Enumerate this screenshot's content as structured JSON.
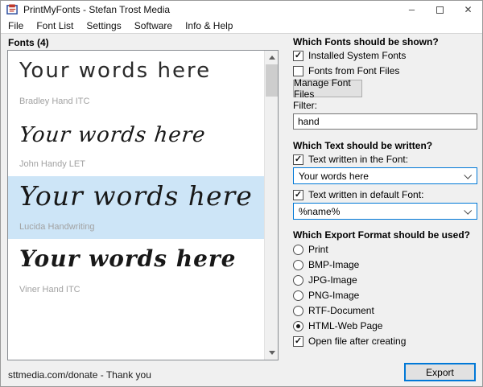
{
  "window": {
    "title": "PrintMyFonts - Stefan Trost Media",
    "icons": {
      "minimize_glyph": "–",
      "close_glyph": "✕"
    }
  },
  "menu": {
    "items": [
      "File",
      "Font List",
      "Settings",
      "Software",
      "Info & Help"
    ]
  },
  "fonts_panel": {
    "header": "Fonts (4)",
    "items": [
      {
        "preview": "Your words here",
        "font_name": "Bradley Hand ITC",
        "selected": false
      },
      {
        "preview": "Your words here",
        "font_name": "John Handy LET",
        "selected": false
      },
      {
        "preview": "Your words here",
        "font_name": "Lucida Handwriting",
        "selected": true
      },
      {
        "preview": "Your words here",
        "font_name": "Viner Hand ITC",
        "selected": false
      }
    ]
  },
  "options_panel": {
    "fonts_section": {
      "header": "Which Fonts should be shown?",
      "checkboxes": [
        {
          "label": "Installed System Fonts",
          "checked": true
        },
        {
          "label": "Fonts from Font Files",
          "checked": false
        }
      ],
      "manage_button": "Manage Font Files",
      "filter_label": "Filter:",
      "filter_value": "hand"
    },
    "text_section": {
      "header": "Which Text should be written?",
      "font_text_checkbox": {
        "label": "Text written in the Font:",
        "checked": true
      },
      "font_text_value": "Your words here",
      "default_text_checkbox": {
        "label": "Text written in default Font:",
        "checked": true
      },
      "default_text_value": "%name%"
    },
    "export_section": {
      "header": "Which Export Format should be used?",
      "options": [
        {
          "label": "Print",
          "selected": false
        },
        {
          "label": "BMP-Image",
          "selected": false
        },
        {
          "label": "JPG-Image",
          "selected": false
        },
        {
          "label": "PNG-Image",
          "selected": false
        },
        {
          "label": "RTF-Document",
          "selected": false
        },
        {
          "label": "HTML-Web Page",
          "selected": true
        }
      ],
      "open_after_checkbox": {
        "label": "Open file after creating",
        "checked": true
      }
    }
  },
  "statusbar": {
    "text": "sttmedia.com/donate - Thank you",
    "export_button": "Export"
  },
  "colors": {
    "accent": "#0078d7",
    "selection_background": "#cde5f7",
    "client_background": "#f0f0f0",
    "font_name_gray": "#a2a2a2"
  }
}
